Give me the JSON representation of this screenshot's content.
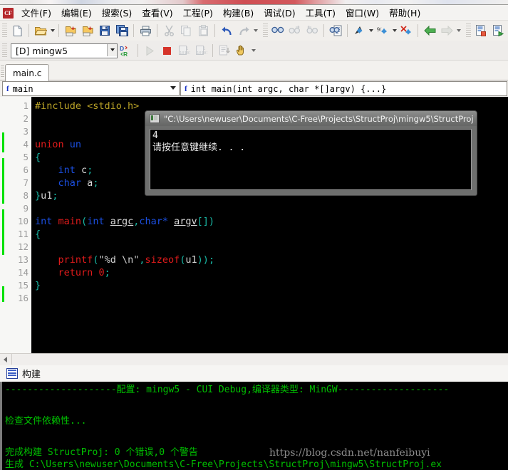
{
  "app": {
    "icon_label": "CF"
  },
  "menubar": {
    "items": [
      {
        "label": "文件(F)",
        "name": "menu-file"
      },
      {
        "label": "编辑(E)",
        "name": "menu-edit"
      },
      {
        "label": "搜索(S)",
        "name": "menu-search"
      },
      {
        "label": "查看(V)",
        "name": "menu-view"
      },
      {
        "label": "工程(P)",
        "name": "menu-project"
      },
      {
        "label": "构建(B)",
        "name": "menu-build"
      },
      {
        "label": "调试(D)",
        "name": "menu-debug"
      },
      {
        "label": "工具(T)",
        "name": "menu-tools"
      },
      {
        "label": "窗口(W)",
        "name": "menu-window"
      },
      {
        "label": "帮助(H)",
        "name": "menu-help"
      }
    ]
  },
  "toolbar_main": {
    "buttons": [
      {
        "name": "new-file-icon",
        "glyph": "new"
      },
      {
        "name": "open-file-icon",
        "glyph": "open"
      },
      {
        "name": "open-dropdown-caret",
        "glyph": "caret"
      },
      {
        "name": "open-project-icon",
        "glyph": "openproj"
      },
      {
        "name": "save-project-icon",
        "glyph": "saveproj"
      },
      {
        "name": "save-icon",
        "glyph": "save"
      },
      {
        "name": "save-all-icon",
        "glyph": "saveall"
      },
      {
        "name": "print-icon",
        "glyph": "print"
      },
      {
        "name": "cut-icon",
        "glyph": "cut"
      },
      {
        "name": "copy-icon",
        "glyph": "copy"
      },
      {
        "name": "paste-icon",
        "glyph": "paste"
      },
      {
        "name": "undo-icon",
        "glyph": "undo"
      },
      {
        "name": "redo-icon",
        "glyph": "redo"
      },
      {
        "name": "find-icon",
        "glyph": "find"
      },
      {
        "name": "find-next-icon",
        "glyph": "findnext"
      },
      {
        "name": "find-prev-icon",
        "glyph": "findprev"
      },
      {
        "name": "find-in-files-icon",
        "glyph": "findfiles"
      },
      {
        "name": "bookmark-toggle-icon",
        "glyph": "bm"
      },
      {
        "name": "bookmark-next-icon",
        "glyph": "bm2"
      },
      {
        "name": "bookmark-clear-icon",
        "glyph": "bm3"
      },
      {
        "name": "nav-back-icon",
        "glyph": "back"
      },
      {
        "name": "nav-forward-icon",
        "glyph": "fwd"
      },
      {
        "name": "compile-icon",
        "glyph": "compile"
      },
      {
        "name": "build-run-icon",
        "glyph": "buildrun"
      },
      {
        "name": "stop-build-icon",
        "glyph": "stopbuild"
      }
    ]
  },
  "toolbar_build": {
    "config_value": "[D] mingw5",
    "buttons": [
      {
        "name": "debug-release-toggle-icon",
        "glyph": "dr"
      },
      {
        "name": "run-icon",
        "glyph": "run"
      },
      {
        "name": "stop-icon",
        "glyph": "stop"
      },
      {
        "name": "step-into-icon",
        "glyph": "stepin"
      },
      {
        "name": "step-over-icon",
        "glyph": "stepover"
      },
      {
        "name": "run-to-cursor-icon",
        "glyph": "runcursor"
      },
      {
        "name": "pause-hand-icon",
        "glyph": "hand"
      }
    ]
  },
  "tabs": {
    "items": [
      {
        "label": "main.c",
        "name": "tab-main-c",
        "active": true
      }
    ]
  },
  "navbar": {
    "scope": "main",
    "symbol": "int main(int argc,  char *[]argv) {...}",
    "fn_icon": "f"
  },
  "editor": {
    "line_numbers": [
      "1",
      "2",
      "3",
      "4",
      "5",
      "6",
      "7",
      "8",
      "9",
      "10",
      "11",
      "12",
      "13",
      "14",
      "15",
      "16"
    ],
    "lines": [
      {
        "n": 1,
        "text": "#include <stdio.h>"
      },
      {
        "n": 2,
        "text": ""
      },
      {
        "n": 3,
        "text": ""
      },
      {
        "n": 4,
        "text": "union un"
      },
      {
        "n": 5,
        "text": "{"
      },
      {
        "n": 6,
        "text": "    int c;"
      },
      {
        "n": 7,
        "text": "    char a;"
      },
      {
        "n": 8,
        "text": "}u1;"
      },
      {
        "n": 9,
        "text": ""
      },
      {
        "n": 10,
        "text": "int main(int argc,char* argv[])"
      },
      {
        "n": 11,
        "text": "{"
      },
      {
        "n": 12,
        "text": ""
      },
      {
        "n": 13,
        "text": "    printf(\"%d \\n\",sizeof(u1));"
      },
      {
        "n": 14,
        "text": "    return 0;"
      },
      {
        "n": 15,
        "text": "}"
      },
      {
        "n": 16,
        "text": ""
      }
    ],
    "change_marker_color": "#00e000"
  },
  "console_window": {
    "title": "\"C:\\Users\\newuser\\Documents\\C-Free\\Projects\\StructProj\\mingw5\\StructProj",
    "output_lines": [
      "4",
      "请按任意键继续. . ."
    ]
  },
  "build_panel": {
    "header": "构建",
    "lines": [
      "--------------------配置: mingw5 - CUI Debug,编译器类型: MinGW--------------------",
      "",
      "检查文件依赖性...",
      "",
      "完成构建 StructProj: 0 个错误,0 个警告",
      "生成 C:\\Users\\newuser\\Documents\\C-Free\\Projects\\StructProj\\mingw5\\StructProj.ex"
    ],
    "text_color": "#00c000"
  },
  "watermark": {
    "text": "https://blog.csdn.net/nanfeibuyi"
  }
}
